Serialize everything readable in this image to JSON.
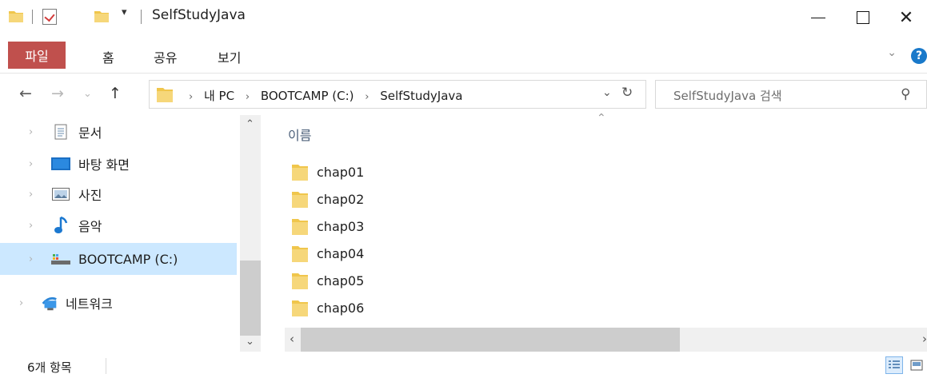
{
  "window": {
    "title": "SelfStudyJava",
    "dropdown_glyph": "▾",
    "controls": {
      "minimize": "",
      "maximize": "",
      "close": "✕"
    }
  },
  "ribbon": {
    "tabs": [
      "파일",
      "홈",
      "공유",
      "보기"
    ],
    "expand_glyph": "⌄",
    "help_glyph": "?"
  },
  "nav": {
    "back": "←",
    "forward": "→",
    "recent": "⌄",
    "up": "↑"
  },
  "address": {
    "crumbs": [
      "내 PC",
      "BOOTCAMP (C:)",
      "SelfStudyJava"
    ],
    "separator": "›",
    "dropdown": "⌄",
    "refresh": "↻"
  },
  "search": {
    "placeholder": "SelfStudyJava 검색",
    "icon": "search-icon"
  },
  "sidebar": {
    "items": [
      {
        "label": "문서",
        "icon": "documents-icon"
      },
      {
        "label": "바탕 화면",
        "icon": "desktop-icon"
      },
      {
        "label": "사진",
        "icon": "pictures-icon"
      },
      {
        "label": "음악",
        "icon": "music-icon"
      },
      {
        "label": "BOOTCAMP (C:)",
        "icon": "drive-icon",
        "selected": true
      },
      {
        "label": "네트워크",
        "icon": "network-icon"
      }
    ],
    "expand_glyph": "›",
    "scroll_up": "⌃",
    "scroll_down": "⌄"
  },
  "content": {
    "column_header": "이름",
    "sort_glyph": "⌃",
    "files": [
      "chap01",
      "chap02",
      "chap03",
      "chap04",
      "chap05",
      "chap06"
    ],
    "hscroll_left": "‹",
    "hscroll_right": "›"
  },
  "status": {
    "item_count": "6개 항목"
  },
  "colors": {
    "file_tab": "#c0504d",
    "selected_row": "#cce8ff",
    "folder": "#f0c64c",
    "help": "#1979ca"
  }
}
